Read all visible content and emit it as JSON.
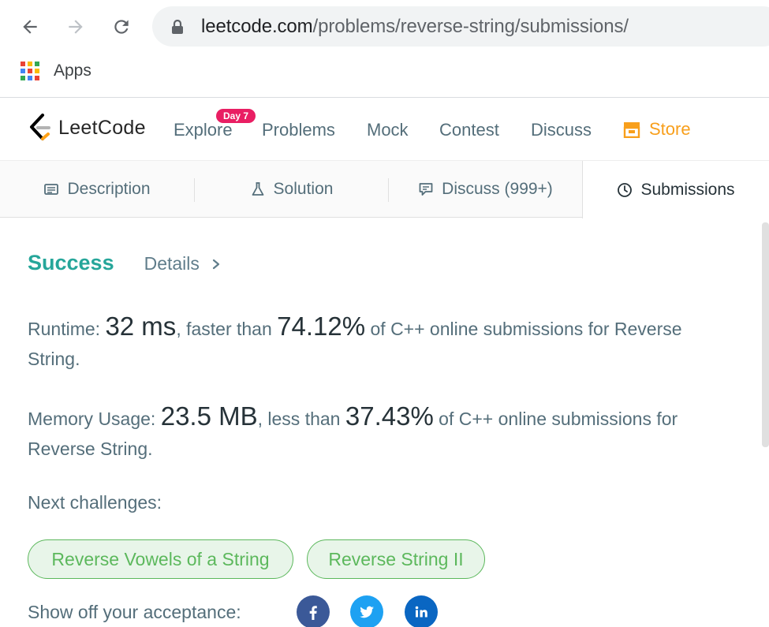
{
  "browser": {
    "url_host": "leetcode.com",
    "url_path": "/problems/reverse-string/submissions/",
    "bookmarks": {
      "apps_label": "Apps"
    }
  },
  "navbar": {
    "logo_text": "LeetCode",
    "items": [
      "Explore",
      "Problems",
      "Mock",
      "Contest",
      "Discuss"
    ],
    "badge": "Day 7",
    "store_label": "Store"
  },
  "tabs": {
    "description": "Description",
    "solution": "Solution",
    "discuss": "Discuss (999+)",
    "submissions": "Submissions"
  },
  "result": {
    "status": "Success",
    "details_label": "Details",
    "runtime": {
      "label": "Runtime: ",
      "value": "32 ms",
      "mid": ", faster than ",
      "percent": "74.12%",
      "tail": " of C++ online submissions for Reverse String."
    },
    "memory": {
      "label": "Memory Usage: ",
      "value": "23.5 MB",
      "mid": ", less than ",
      "percent": "37.43%",
      "tail": " of C++ online submissions for Reverse String."
    },
    "next_label": "Next challenges:",
    "challenges": [
      "Reverse Vowels of a String",
      "Reverse String II"
    ],
    "show_off_label": "Show off your acceptance:"
  },
  "colors": {
    "success": "#26a69a",
    "chip_border": "#5cb85c",
    "chip_bg": "#e8f5e9",
    "badge": "#e91e63",
    "store": "#f89f1b",
    "facebook": "#3b5998",
    "twitter": "#1da1f2",
    "linkedin": "#0a66c2"
  },
  "icons": {
    "back": "arrow-left-icon",
    "forward": "arrow-right-icon",
    "reload": "reload-icon",
    "lock": "lock-icon",
    "apps": "apps-grid-icon",
    "store": "store-icon",
    "description": "description-icon",
    "solution": "flask-icon",
    "discuss": "comment-icon",
    "submissions": "clock-icon",
    "details": "chevron-right-icon",
    "social": [
      "facebook-icon",
      "twitter-icon",
      "linkedin-icon"
    ]
  }
}
